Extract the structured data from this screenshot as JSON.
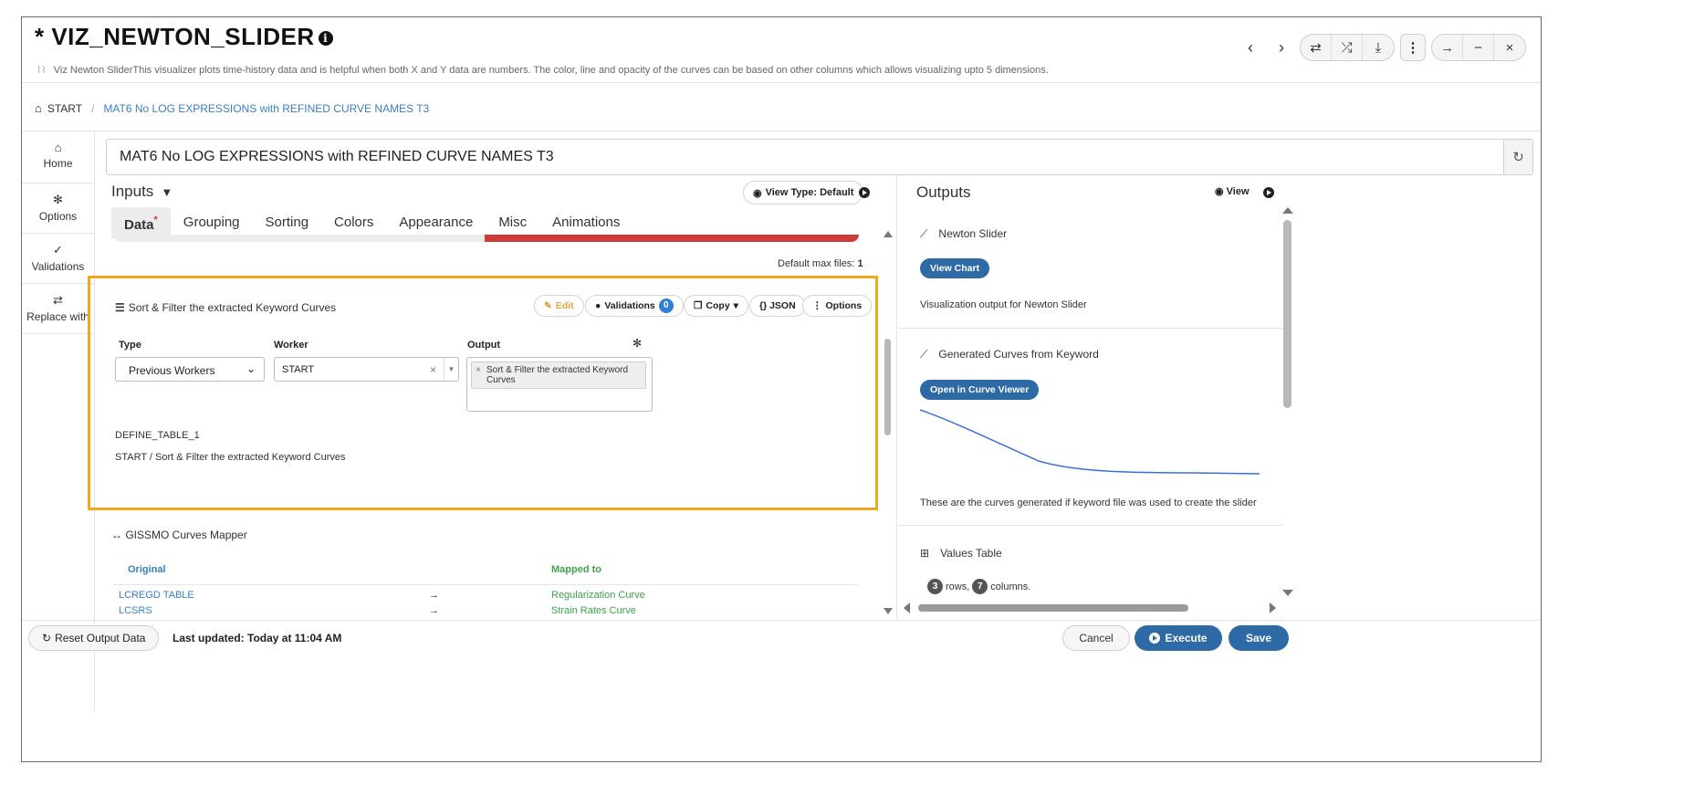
{
  "header": {
    "title": "* VIZ_NEWTON_SLIDER",
    "info_icon": "info-circle-icon",
    "logo_text": "Viz",
    "description": "Newton SliderThis visualizer plots time-history data and is helpful when both X and Y data are numbers. The color, line and opacity of the curves can be based on other columns which allows visualizing upto 5 dimensions.",
    "controls": {
      "prev": "‹",
      "next": "›",
      "swap": "⇄",
      "shuffle": "⤮",
      "download": "⤓",
      "more": "⋮",
      "forward": "→",
      "minimize": "−",
      "close": "×"
    }
  },
  "breadcrumb": {
    "home": "START",
    "separator": "/",
    "current": "MAT6 No LOG EXPRESSIONS with REFINED CURVE NAMES T3"
  },
  "sidebar": {
    "items": [
      {
        "label": "Home",
        "icon": "home-icon",
        "glyph": "⌂"
      },
      {
        "label": "Options",
        "icon": "gear-icon",
        "glyph": "✻"
      },
      {
        "label": "Validations",
        "icon": "check-double-icon",
        "glyph": "✓"
      },
      {
        "label": "Replace with",
        "icon": "swap-icon",
        "glyph": "⇄"
      }
    ]
  },
  "title_field": {
    "value": "MAT6 No LOG EXPRESSIONS with REFINED CURVE NAMES T3",
    "refresh_glyph": "↻"
  },
  "inputs": {
    "label": "Inputs",
    "filter_glyph": "▼",
    "view_type": "View Type: Default",
    "tabs": [
      "Data",
      "Grouping",
      "Sorting",
      "Colors",
      "Appearance",
      "Misc",
      "Animations"
    ],
    "active_tab": "Data",
    "required_mark": "*",
    "max_files_label": "Default max files:",
    "max_files_value": "1"
  },
  "worker_panel": {
    "title": "Sort & Filter the extracted Keyword Curves",
    "buttons": {
      "edit": "Edit",
      "validations": "Validations",
      "validations_count": "0",
      "copy": "Copy",
      "json": "{} JSON",
      "options": "Options"
    },
    "fields": {
      "type_label": "Type",
      "type_value": "Previous Workers",
      "worker_label": "Worker",
      "worker_value": "START",
      "output_label": "Output",
      "output_tag": "Sort & Filter the extracted Keyword Curves"
    },
    "table_name": "DEFINE_TABLE_1",
    "path": "START / Sort & Filter the extracted Keyword Curves"
  },
  "gissmo": {
    "title": "GISSMO Curves Mapper",
    "col_original": "Original",
    "col_mapped": "Mapped to",
    "rows": [
      {
        "original": "LCREGD TABLE",
        "arrow": "→",
        "mapped": "Regularization Curve"
      },
      {
        "original": "LCSRS",
        "arrow": "→",
        "mapped": "Strain Rates Curve"
      }
    ]
  },
  "outputs": {
    "label": "Outputs",
    "view_label": "View",
    "sections": [
      {
        "title": "Newton Slider",
        "button": "View Chart",
        "text": "Visualization output for Newton Slider"
      },
      {
        "title": "Generated Curves from Keyword",
        "button": "Open in Curve Viewer",
        "text": "These are the curves generated if keyword file was used to create the slider"
      },
      {
        "title": "Values Table",
        "rows_count": "3",
        "rows_label": "rows,",
        "cols_count": "7",
        "cols_label": "columns."
      }
    ],
    "curve_color": "#3b6fd6"
  },
  "footer": {
    "reset": "Reset Output Data",
    "last_updated": "Last updated: Today at 11:04 AM",
    "cancel": "Cancel",
    "execute": "Execute",
    "save": "Save"
  },
  "colors": {
    "accent": "#2d6aa6",
    "highlight": "#f0a81c",
    "danger": "#cf3b3b",
    "link": "#3a7fc4",
    "mapped": "#3da34a"
  }
}
